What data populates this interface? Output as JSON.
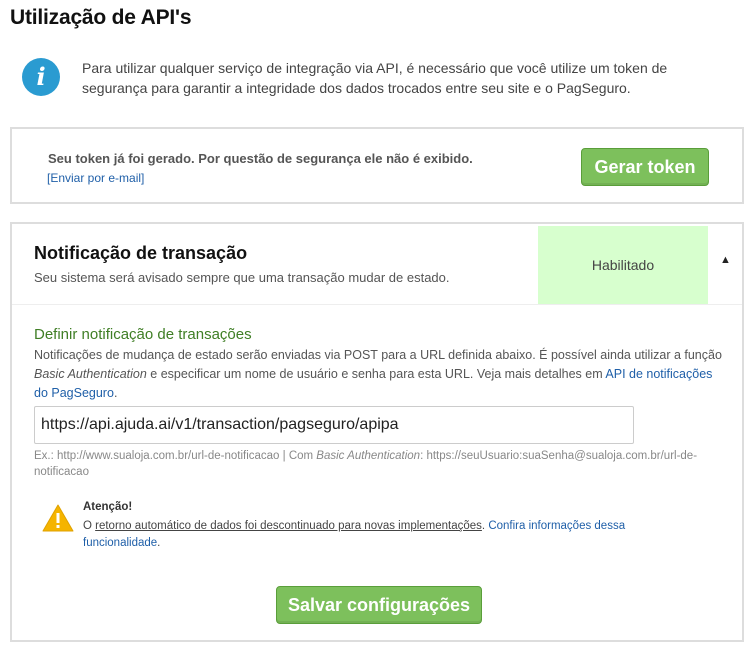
{
  "page": {
    "title": "Utilização de API's"
  },
  "info": {
    "icon": "info-icon",
    "text": "Para utilizar qualquer serviço de integração via API, é necessário que você utilize um token de segurança para garantir a integridade dos dados trocados entre seu site e o PagSeguro."
  },
  "token": {
    "message": "Seu token já foi gerado. Por questão de segurança ele não é exibido.",
    "email_link": "[Enviar por e-mail]",
    "generate_button": "Gerar token"
  },
  "notification": {
    "title": "Notificação de transação",
    "subtitle": "Seu sistema será avisado sempre que uma transação mudar de estado.",
    "status": "Habilitado",
    "collapse_icon": "caret-up-icon",
    "section_title": "Definir notificação de transações",
    "desc_part1": "Notificações de mudança de estado serão enviadas via POST para a URL definida abaixo. É possível ainda utilizar a função ",
    "desc_em": "Basic Authentication",
    "desc_part2": " e especificar um nome de usuário e senha para esta URL. Veja mais detalhes em ",
    "desc_link": "API de notificações do PagSeguro",
    "desc_end": ".",
    "url_value": "https://api.ajuda.ai/v1/transaction/pagseguro/apipa",
    "example_part1": "Ex.: http://www.sualoja.com.br/url-de-notificacao | Com ",
    "example_em": "Basic Authentication",
    "example_part2": ": https://seuUsuario:suaSenha@sualoja.com.br/url-de-notificacao",
    "warning": {
      "icon": "warning-icon",
      "title": "Atenção!",
      "prefix": "O ",
      "underlined": "retorno automático de dados foi descontinuado para novas implementações",
      "middle": ". ",
      "link": "Confira informações dessa funcionalidade",
      "suffix": "."
    },
    "save_button": "Salvar configurações"
  },
  "colors": {
    "accent_green": "#7dc05c",
    "status_bg": "#d7ffce",
    "section_title": "#3f7e25",
    "link": "#1f5fa8",
    "info_icon": "#2a9bd1",
    "warning_icon": "#f5b400"
  }
}
